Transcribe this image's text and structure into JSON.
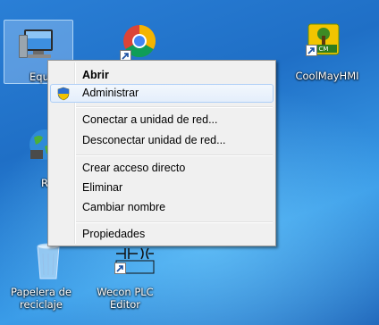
{
  "desktop": {
    "icons": [
      {
        "id": "equipo",
        "label": "Equipo"
      },
      {
        "id": "chrome",
        "label": ""
      },
      {
        "id": "coolmay",
        "label": "CoolMayHMI"
      },
      {
        "id": "red",
        "label": "Red"
      },
      {
        "id": "papelera",
        "label": "Papelera de reciclaje"
      },
      {
        "id": "wecon",
        "label": "Wecon PLC Editor"
      }
    ],
    "visible_partial_labels": {
      "equipo": "Equ",
      "red": "R"
    }
  },
  "context_menu": {
    "items": [
      {
        "label": "Abrir",
        "bold": true
      },
      {
        "label": "Administrar",
        "icon": "shield-icon",
        "hovered": true
      },
      {
        "label": "Conectar a unidad de red..."
      },
      {
        "label": "Desconectar unidad de red..."
      },
      {
        "label": "Crear acceso directo"
      },
      {
        "label": "Eliminar"
      },
      {
        "label": "Cambiar nombre"
      },
      {
        "label": "Propiedades"
      }
    ]
  },
  "colors": {
    "desktop_blue": "#1f6fc6",
    "menu_bg": "#f0f0f0",
    "menu_hover": "#e4eefb",
    "menu_hover_border": "#aecff7"
  }
}
